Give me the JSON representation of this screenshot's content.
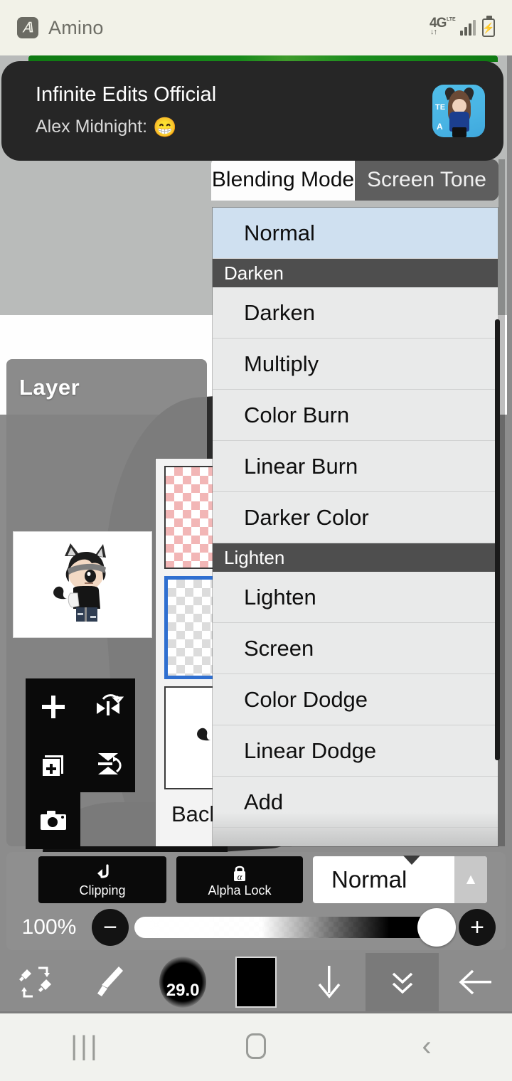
{
  "status_bar": {
    "app_icon": "amino-app-icon",
    "app_name": "Amino",
    "network_type": "4G",
    "network_sub": "LTE",
    "data_arrows": "↓↑",
    "signal_icon": "signal-bars-icon",
    "battery_icon": "battery-charging-icon",
    "battery_glyph": "⚡"
  },
  "notification": {
    "title": "Infinite Edits Official",
    "subtitle": "Alex Midnight:",
    "emoji": "😁",
    "avatar_name": "notification-avatar",
    "accent_color": "#147a17",
    "avatar_bg": "#4fbde8",
    "avatar_badge_top": "TE",
    "avatar_badge_bottom": "A"
  },
  "layer_panel": {
    "title": "Layer",
    "back_label": "Back",
    "tools": [
      {
        "name": "add-layer-button",
        "icon": "plus-icon"
      },
      {
        "name": "flip-horizontal-button",
        "icon": "flip-horizontal-icon"
      },
      {
        "name": "duplicate-layer-button",
        "icon": "copy-plus-icon"
      },
      {
        "name": "flip-vertical-button",
        "icon": "flip-vertical-icon"
      },
      {
        "name": "camera-button",
        "icon": "camera-icon"
      }
    ],
    "thumbnails": [
      {
        "name": "layer-thumb-top",
        "type": "checker-pink",
        "selected": false
      },
      {
        "name": "layer-thumb-middle",
        "type": "checker-gray",
        "selected": true
      },
      {
        "name": "layer-thumb-bottom",
        "type": "artwork",
        "selected": false
      }
    ]
  },
  "blend_popup": {
    "tabs": [
      {
        "label": "Blending Mode",
        "active": true
      },
      {
        "label": "Screen Tone",
        "active": false
      }
    ],
    "items": [
      {
        "label": "Normal",
        "type": "item",
        "selected": true
      },
      {
        "label": "Darken",
        "type": "group"
      },
      {
        "label": "Darken",
        "type": "item",
        "selected": false
      },
      {
        "label": "Multiply",
        "type": "item",
        "selected": false
      },
      {
        "label": "Color Burn",
        "type": "item",
        "selected": false
      },
      {
        "label": "Linear Burn",
        "type": "item",
        "selected": false
      },
      {
        "label": "Darker Color",
        "type": "item",
        "selected": false
      },
      {
        "label": "Lighten",
        "type": "group"
      },
      {
        "label": "Lighten",
        "type": "item",
        "selected": false
      },
      {
        "label": "Screen",
        "type": "item",
        "selected": false
      },
      {
        "label": "Color Dodge",
        "type": "item",
        "selected": false
      },
      {
        "label": "Linear Dodge",
        "type": "item",
        "selected": false
      },
      {
        "label": "Add",
        "type": "item",
        "selected": false
      }
    ],
    "selected_highlight_color": "#cfe0f0",
    "group_header_color": "#4e4e4e"
  },
  "layer_bottom_bar": {
    "clipping_label": "Clipping",
    "clipping_icon": "clipping-arrow-icon",
    "alpha_lock_label": "Alpha Lock",
    "alpha_lock_icon": "alpha-lock-icon",
    "alpha_lock_glyph": "α",
    "blend_mode_value": "Normal",
    "blend_expand_icon": "triangle-up-icon",
    "opacity_label": "100%",
    "opacity_percent": 100,
    "decrease_icon": "minus-icon",
    "increase_icon": "plus-icon"
  },
  "toolbar": {
    "items": [
      {
        "name": "undo-redo-tool",
        "icon": "brush-eraser-swap-icon",
        "active": false
      },
      {
        "name": "brush-tool",
        "icon": "paintbrush-icon",
        "active": false
      },
      {
        "name": "brush-size-tool",
        "icon": "brush-size-icon",
        "value": "29.0",
        "active": false
      },
      {
        "name": "color-swatch-tool",
        "icon": "color-swatch-icon",
        "color": "#000000",
        "active": false
      },
      {
        "name": "download-tool",
        "icon": "arrow-down-icon",
        "active": false
      },
      {
        "name": "collapse-tool",
        "icon": "chevron-double-down-icon",
        "active": true
      },
      {
        "name": "back-tool",
        "icon": "arrow-left-icon",
        "active": false
      }
    ]
  },
  "navbar": {
    "recents": "|||",
    "home_icon": "home-circle-icon",
    "back_icon": "back-chevron-icon",
    "back_glyph": "‹"
  }
}
